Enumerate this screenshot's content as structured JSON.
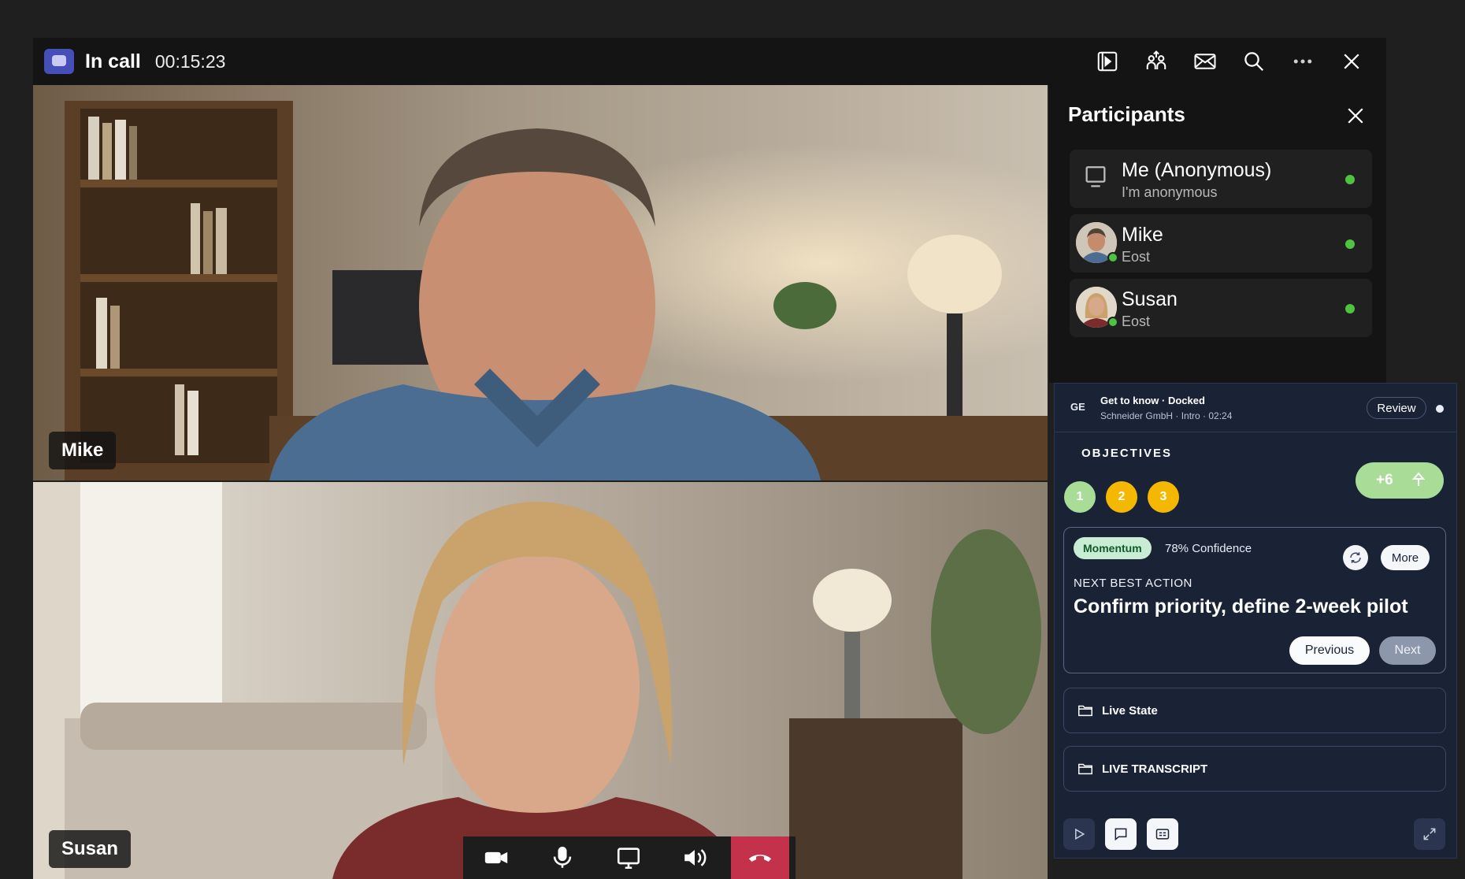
{
  "titlebar": {
    "title": "In call",
    "timer": "00:15:23",
    "icons": [
      "share-tray-icon",
      "people-share-icon",
      "mail-icon",
      "search-icon",
      "more-icon",
      "close-icon"
    ]
  },
  "videos": [
    {
      "name": "Mike"
    },
    {
      "name": "Susan"
    }
  ],
  "controls": [
    "camera-icon",
    "microphone-icon",
    "share-screen-icon",
    "speaker-icon",
    "hang-up-icon"
  ],
  "participants": {
    "title": "Participants",
    "items": [
      {
        "name": "Me (Anonymous)",
        "sub": "I'm anonymous"
      },
      {
        "name": "Mike",
        "sub": "Eost"
      },
      {
        "name": "Susan",
        "sub": "Eost"
      }
    ]
  },
  "coach": {
    "initials": "GE",
    "title": "Get to know · Docked",
    "subtitle": "Schneider GmbH · Intro · 02:24",
    "review_label": "Review",
    "objectives_label": "OBJECTIVES",
    "objectives": [
      {
        "num": "1",
        "color": "#a8dc97"
      },
      {
        "num": "2",
        "color": "#f5b800"
      },
      {
        "num": "3",
        "color": "#f5b800"
      }
    ],
    "plus_label": "+6",
    "nba": {
      "badge": "Momentum",
      "confidence": "78% Confidence",
      "more_label": "More",
      "label": "NEXT BEST ACTION",
      "text": "Confirm priority, define 2-week pilot",
      "previous_label": "Previous",
      "next_label": "Next"
    },
    "sections": [
      "Live State",
      "LIVE TRANSCRIPT"
    ]
  },
  "colors": {
    "accent": "#464eb8",
    "end_call": "#c4314b",
    "online": "#4fc23f",
    "coach_bg": "#1a2236"
  }
}
